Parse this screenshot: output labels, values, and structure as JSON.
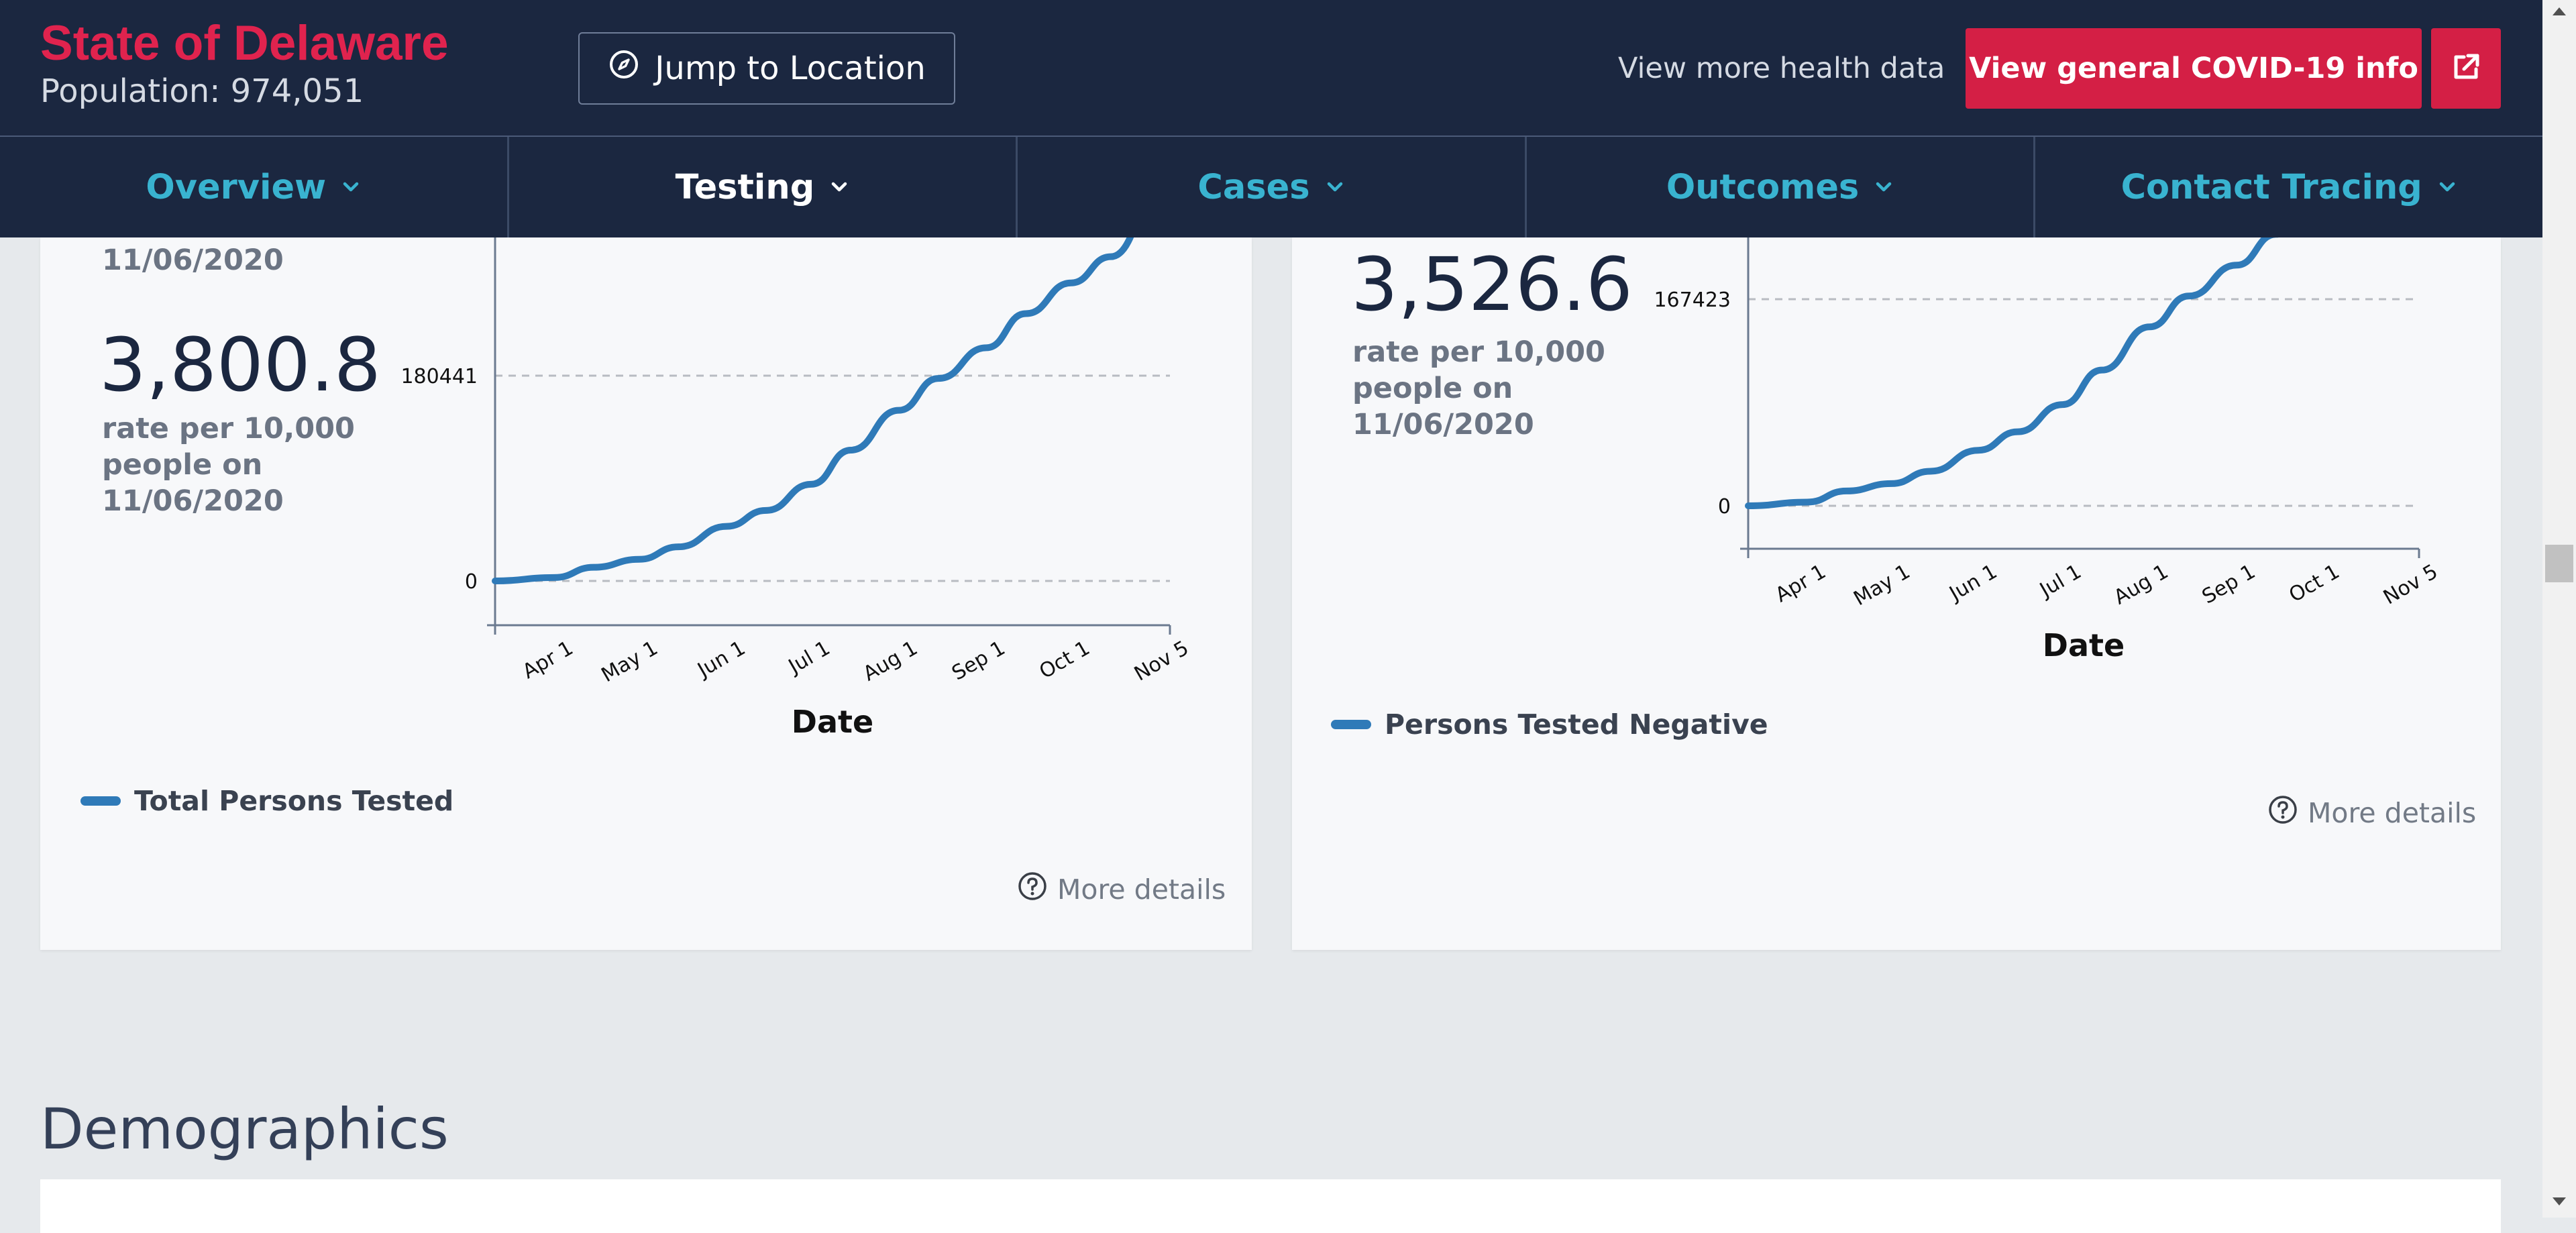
{
  "header": {
    "title": "State of Delaware",
    "population": "Population: 974,051",
    "jump_label": "Jump to Location",
    "health_link": "View more health data",
    "covid_btn": "View general COVID-19 info"
  },
  "nav": {
    "tabs": [
      {
        "label": "Overview",
        "active": false
      },
      {
        "label": "Testing",
        "active": true
      },
      {
        "label": "Cases",
        "active": false
      },
      {
        "label": "Outcomes",
        "active": false
      },
      {
        "label": "Contact Tracing",
        "active": false
      }
    ]
  },
  "cards": {
    "left": {
      "date_top": "11/06/2020",
      "value": "3,800.8",
      "desc_line1": "rate per 10,000",
      "desc_line2": "people on",
      "desc_line3": "11/06/2020",
      "legend": "Total Persons Tested",
      "more": "More details"
    },
    "right": {
      "value": "3,526.6",
      "desc_line1": "rate per 10,000",
      "desc_line2": "people on",
      "desc_line3": "11/06/2020",
      "legend": "Persons Tested Negative",
      "more": "More details"
    }
  },
  "demographics": {
    "title": "Demographics"
  },
  "colors": {
    "accent_red": "#d41f45",
    "nav_teal": "#39b3d0",
    "navy": "#1b2740",
    "line_blue": "#2f7ab8"
  },
  "icons": {
    "jump": "compass-icon",
    "external": "external-link-icon",
    "nav": "chevron-down-icon",
    "help": "question-circle-icon"
  },
  "chart_data": [
    {
      "type": "line",
      "xlabel": "Date",
      "x_ticks": [
        "Apr 1",
        "May 1",
        "Jun 1",
        "Jul 1",
        "Aug 1",
        "Sep 1",
        "Oct 1",
        "Nov 5"
      ],
      "y_ticks": [
        0,
        180441
      ],
      "grid": "horizontal dashed at ticks",
      "series": [
        {
          "name": "Total Persons Tested",
          "values": [
            [
              "Mar 11",
              0
            ],
            [
              "Apr 1",
              3000
            ],
            [
              "Apr 15",
              12000
            ],
            [
              "May 1",
              19000
            ],
            [
              "May 15",
              30000
            ],
            [
              "Jun 1",
              48000
            ],
            [
              "Jun 15",
              62000
            ],
            [
              "Jul 1",
              85000
            ],
            [
              "Jul 15",
              115000
            ],
            [
              "Aug 1",
              150000
            ],
            [
              "Aug 15",
              178000
            ],
            [
              "Sep 1",
              205000
            ],
            [
              "Sep 15",
              235000
            ],
            [
              "Oct 1",
              262000
            ],
            [
              "Oct 15",
              285000
            ],
            [
              "Nov 5",
              370000
            ]
          ]
        }
      ]
    },
    {
      "type": "line",
      "xlabel": "Date",
      "x_ticks": [
        "Apr 1",
        "May 1",
        "Jun 1",
        "Jul 1",
        "Aug 1",
        "Sep 1",
        "Oct 1",
        "Nov 5"
      ],
      "y_ticks": [
        0,
        167423
      ],
      "grid": "horizontal dashed at ticks",
      "series": [
        {
          "name": "Persons Tested Negative",
          "values": [
            [
              "Mar 11",
              0
            ],
            [
              "Apr 1",
              3000
            ],
            [
              "Apr 15",
              12000
            ],
            [
              "May 1",
              18000
            ],
            [
              "May 15",
              28000
            ],
            [
              "Jun 1",
              45000
            ],
            [
              "Jun 15",
              60000
            ],
            [
              "Jul 1",
              82000
            ],
            [
              "Jul 15",
              110000
            ],
            [
              "Aug 1",
              145000
            ],
            [
              "Aug 15",
              170000
            ],
            [
              "Sep 1",
              195000
            ],
            [
              "Sep 15",
              220000
            ],
            [
              "Oct 1",
              248000
            ],
            [
              "Oct 15",
              270000
            ],
            [
              "Nov 5",
              345000
            ]
          ]
        }
      ]
    }
  ]
}
